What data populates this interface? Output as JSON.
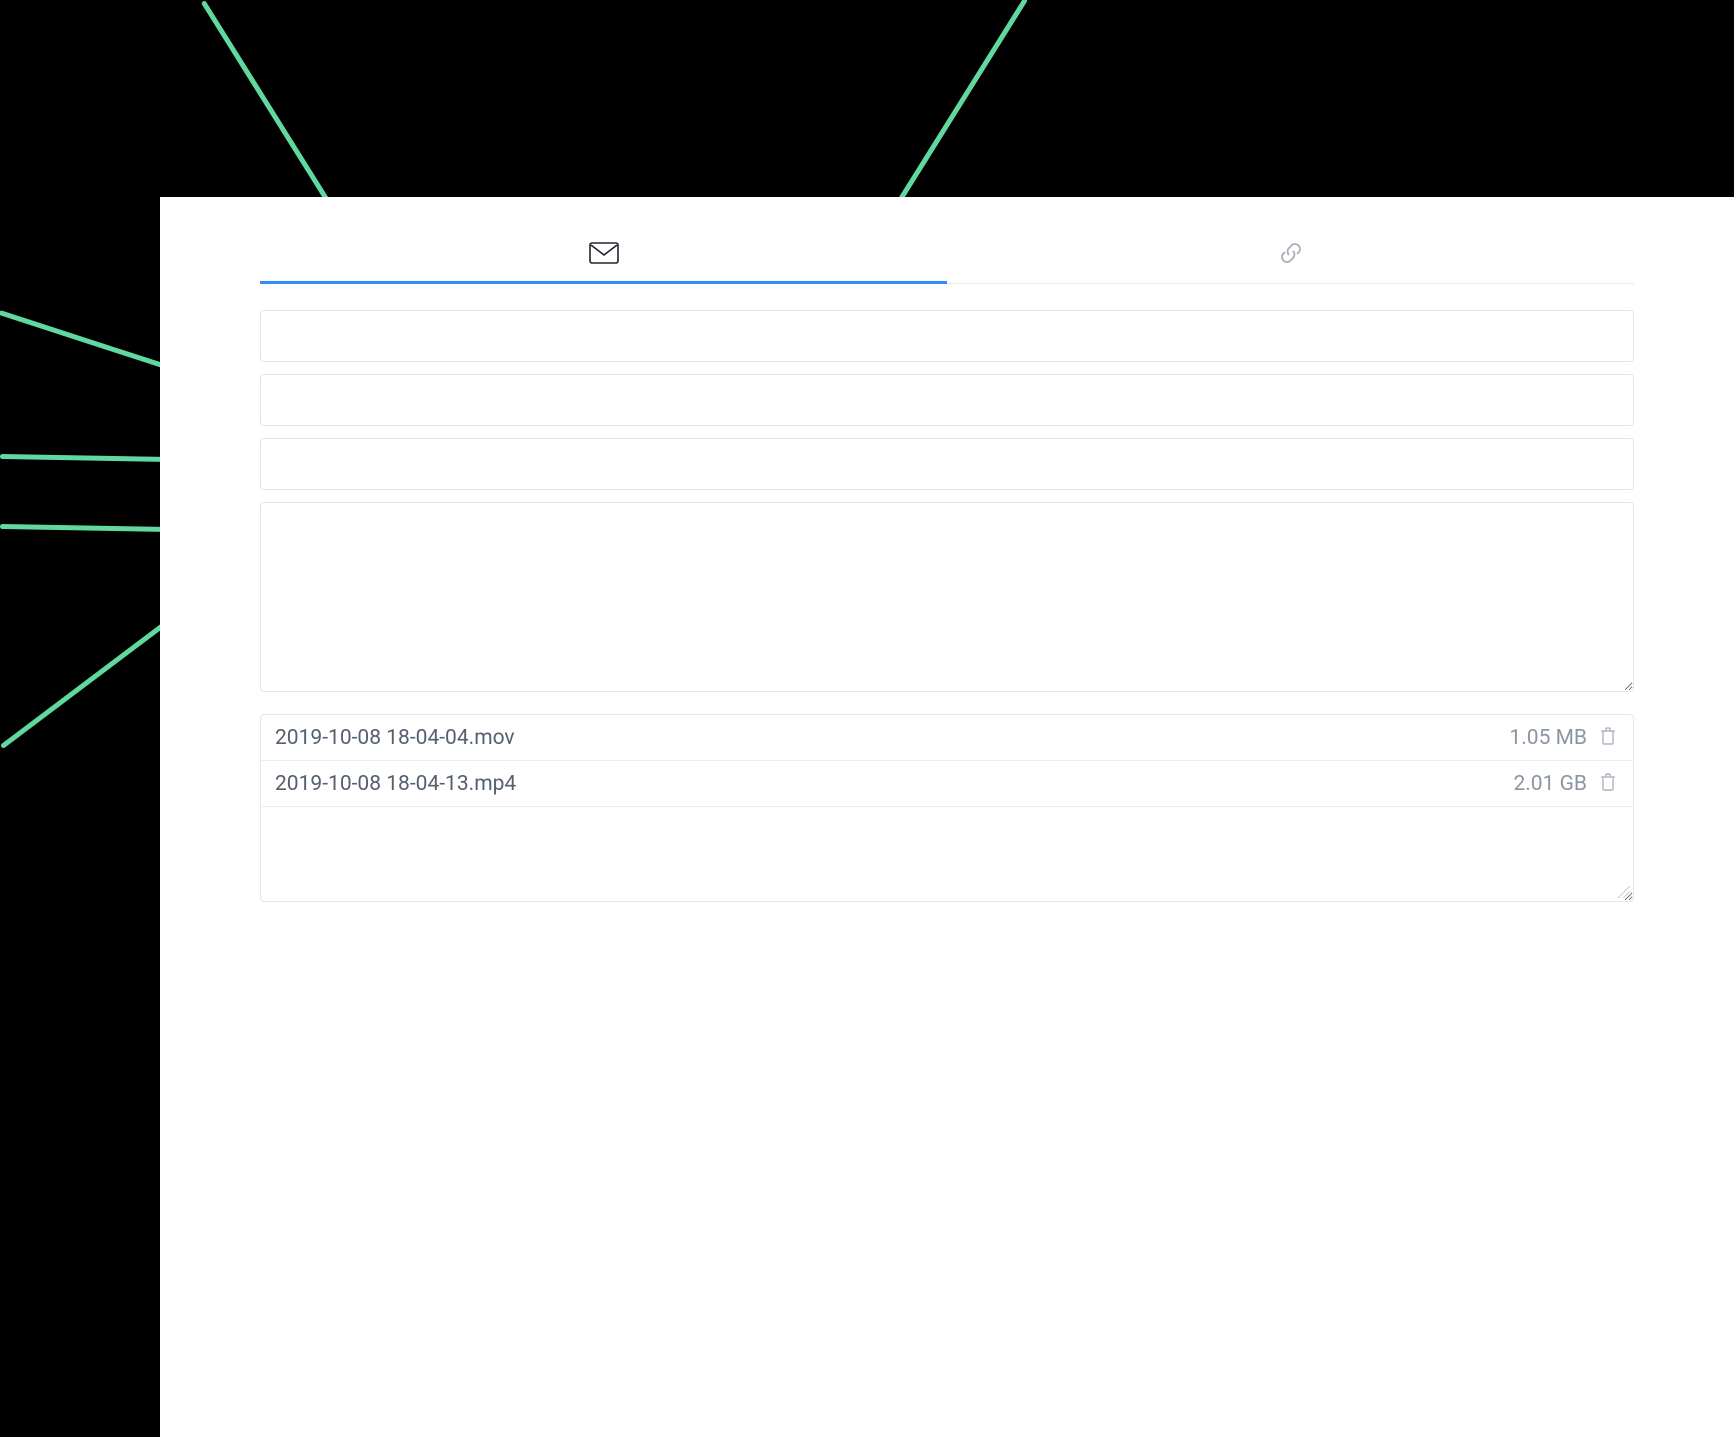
{
  "tabs": {
    "email_icon": "envelope-icon",
    "link_icon": "link-icon"
  },
  "fields": {
    "to_placeholder": "",
    "your_email_placeholder": "",
    "subject_placeholder": "",
    "message_placeholder": ""
  },
  "attachments": [
    {
      "name": "2019-10-08 18-04-04.mov",
      "size": "1.05 MB"
    },
    {
      "name": "2019-10-08 18-04-13.mp4",
      "size": "2.01 GB"
    }
  ],
  "colors": {
    "accent": "#2f8df5",
    "annotation": "#75d8a6"
  }
}
